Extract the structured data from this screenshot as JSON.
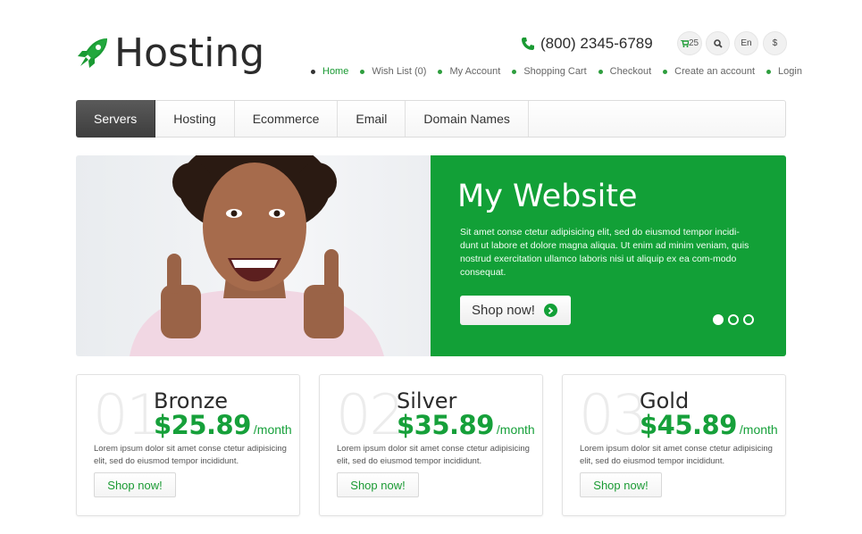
{
  "brand": {
    "name": "Hosting",
    "accent": "#12a037"
  },
  "header": {
    "phone": "(800) 2345-6789",
    "cart_count": "25",
    "language": "En",
    "currency": "$"
  },
  "top_nav": [
    {
      "label": "Home",
      "active": true
    },
    {
      "label": "Wish List (0)"
    },
    {
      "label": "My Account"
    },
    {
      "label": "Shopping Cart"
    },
    {
      "label": "Checkout"
    },
    {
      "label": "Create an account"
    },
    {
      "label": "Login"
    }
  ],
  "menu": [
    {
      "label": "Servers",
      "active": true
    },
    {
      "label": "Hosting"
    },
    {
      "label": "Ecommerce"
    },
    {
      "label": "Email"
    },
    {
      "label": "Domain Names"
    }
  ],
  "hero": {
    "title": "My Website",
    "text": "Sit amet conse ctetur adipisicing elit, sed do eiusmod tempor incidi-dunt ut labore et dolore magna aliqua. Ut enim ad minim veniam, quis nostrud exercitation ullamco laboris nisi ut aliquip ex ea com-modo consequat.",
    "button": "Shop now!",
    "slides_total": 3,
    "active_slide": 1
  },
  "plans": [
    {
      "num": "01",
      "name": "Bronze",
      "price": "$25.89",
      "per": "/month",
      "desc": "Lorem ipsum dolor sit amet conse ctetur adipisicing elit, sed do eiusmod tempor incididunt.",
      "button": "Shop now!"
    },
    {
      "num": "02",
      "name": "Silver",
      "price": "$35.89",
      "per": "/month",
      "desc": "Lorem ipsum dolor sit amet conse ctetur adipisicing elit, sed do eiusmod tempor incididunt.",
      "button": "Shop now!"
    },
    {
      "num": "03",
      "name": "Gold",
      "price": "$45.89",
      "per": "/month",
      "desc": "Lorem ipsum dolor sit amet conse ctetur adipisicing elit, sed do eiusmod tempor incididunt.",
      "button": "Shop now!"
    }
  ]
}
